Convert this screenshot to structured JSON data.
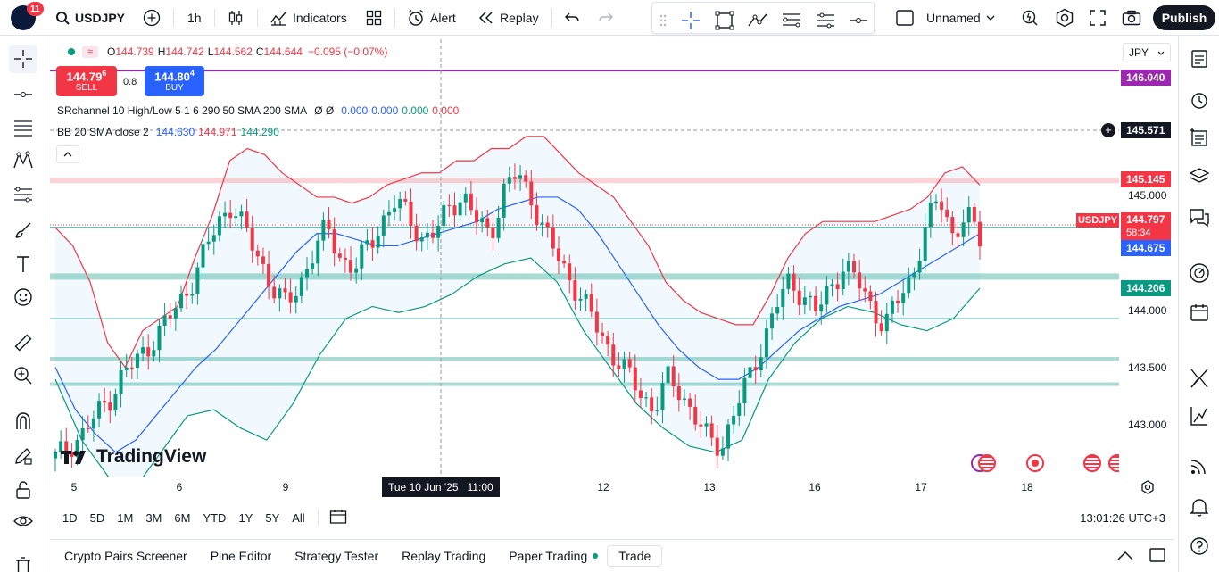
{
  "header": {
    "notification_count": "11",
    "symbol": "USDJPY",
    "interval": "1h",
    "indicators_label": "Indicators",
    "alert_label": "Alert",
    "replay_label": "Replay",
    "layout_name": "Unnamed",
    "publish_label": "Publish"
  },
  "legend": {
    "ohlc": {
      "o_label": "O",
      "o": "144.739",
      "h_label": "H",
      "h": "144.742",
      "l_label": "L",
      "l": "144.562",
      "c_label": "C",
      "c": "144.644",
      "change": "−0.095 (−0.07%)"
    },
    "sell": {
      "price_main": "144.79",
      "price_sup": "6",
      "label": "SELL"
    },
    "spread": "0.8",
    "buy": {
      "price_main": "144.80",
      "price_sup": "4",
      "label": "BUY"
    },
    "srchannel": {
      "name": "SRchannel 10 High/Low 5 1 6 290 50 SMA 200 SMA",
      "flags": "Ø Ø",
      "v1": "0.000",
      "v2": "0.000",
      "v3": "0.000",
      "v4": "0.000"
    },
    "bb": {
      "name": "BB 20 SMA close 2",
      "basis": "144.630",
      "upper": "144.971",
      "lower": "144.290"
    }
  },
  "price_axis": {
    "currency": "JPY",
    "ticks": [
      "145.000",
      "144.000",
      "143.500",
      "143.000"
    ],
    "labels": {
      "purple": "146.040",
      "crosshair": "145.571",
      "red_zone": "145.145",
      "symbol_tag": "USDJPY",
      "last": "144.797",
      "countdown": "58:34",
      "basis": "144.675",
      "lower": "144.206"
    }
  },
  "time_axis": {
    "ticks": [
      "5",
      "6",
      "9",
      "12",
      "13",
      "16",
      "17",
      "18"
    ],
    "crosshair_date": "Tue 10 Jun '25",
    "crosshair_time": "11:00"
  },
  "range_bar": {
    "ranges": [
      "1D",
      "5D",
      "1M",
      "3M",
      "6M",
      "YTD",
      "1Y",
      "5Y",
      "All"
    ],
    "clock": "13:01:26 UTC+3"
  },
  "bottom_panel": {
    "tabs": [
      "Crypto Pairs Screener",
      "Pine Editor",
      "Strategy Tester",
      "Replay Trading",
      "Paper Trading"
    ],
    "trade_label": "Trade"
  },
  "watermark": "TradingView",
  "colors": {
    "up": "#089981",
    "down": "#f23645",
    "basis": "#2962ff",
    "upper_band": "#f23645",
    "lower_band": "#089981",
    "purple_line": "#9c27b0",
    "accent_blue": "#2962ff"
  },
  "chart_data": {
    "type": "candlestick",
    "symbol": "USDJPY",
    "interval": "1h",
    "ylim": [
      142.7,
      146.3
    ],
    "x_ticks": [
      "5",
      "6",
      "9",
      "12",
      "13",
      "16",
      "17",
      "18"
    ],
    "horizontal_levels": [
      146.04,
      145.145,
      144.75,
      144.35,
      144.0,
      143.67,
      143.46
    ],
    "close_series": [
      142.85,
      142.95,
      143.05,
      143.2,
      143.35,
      143.55,
      143.65,
      143.8,
      143.95,
      144.1,
      144.3,
      144.55,
      144.8,
      144.95,
      144.7,
      144.5,
      144.25,
      144.1,
      144.3,
      144.55,
      144.75,
      144.5,
      144.4,
      144.6,
      144.8,
      144.95,
      144.85,
      144.65,
      144.7,
      144.95,
      145.0,
      144.8,
      144.7,
      145.05,
      145.2,
      145.0,
      144.7,
      144.5,
      144.3,
      144.1,
      143.9,
      143.7,
      143.55,
      143.4,
      143.25,
      143.5,
      143.4,
      143.2,
      143.0,
      142.95,
      143.25,
      143.5,
      143.8,
      144.1,
      144.3,
      144.2,
      144.05,
      144.25,
      144.45,
      144.3,
      144.1,
      143.95,
      144.15,
      144.35,
      144.75,
      145.0,
      144.7,
      144.85,
      144.65
    ],
    "bb_upper_series": [
      144.75,
      144.6,
      144.3,
      143.8,
      143.6,
      143.9,
      144.0,
      144.1,
      144.5,
      144.85,
      145.3,
      145.4,
      145.35,
      145.2,
      145.1,
      145.0,
      145.0,
      144.95,
      145.0,
      145.1,
      145.15,
      145.2,
      145.2,
      145.3,
      145.3,
      145.4,
      145.4,
      145.5,
      145.5,
      145.35,
      145.2,
      145.1,
      145.0,
      144.8,
      144.6,
      144.3,
      144.15,
      144.05,
      144.0,
      143.95,
      143.95,
      144.2,
      144.5,
      144.7,
      144.8,
      144.8,
      144.8,
      144.8,
      144.85,
      144.9,
      145.0,
      145.2,
      145.25,
      145.1
    ],
    "bb_basis_series": [
      143.6,
      143.25,
      143.05,
      142.9,
      143.0,
      143.2,
      143.4,
      143.6,
      143.75,
      143.95,
      144.15,
      144.35,
      144.55,
      144.7,
      144.7,
      144.65,
      144.6,
      144.6,
      144.65,
      144.7,
      144.75,
      144.8,
      144.9,
      144.95,
      145.0,
      145.0,
      144.9,
      144.7,
      144.45,
      144.2,
      143.95,
      143.75,
      143.6,
      143.5,
      143.5,
      143.6,
      143.75,
      143.9,
      144.0,
      144.1,
      144.15,
      144.2,
      144.3,
      144.4,
      144.5,
      144.6,
      144.7
    ],
    "bb_lower_series": [
      143.5,
      143.0,
      142.7,
      142.6,
      142.9,
      143.2,
      143.25,
      143.1,
      143.0,
      143.3,
      143.7,
      144.0,
      144.1,
      144.05,
      144.1,
      144.2,
      144.35,
      144.45,
      144.5,
      144.3,
      143.9,
      143.6,
      143.3,
      143.1,
      142.95,
      142.9,
      143.0,
      143.5,
      143.8,
      144.0,
      144.1,
      144.05,
      143.95,
      143.9,
      144.0,
      144.25
    ]
  }
}
